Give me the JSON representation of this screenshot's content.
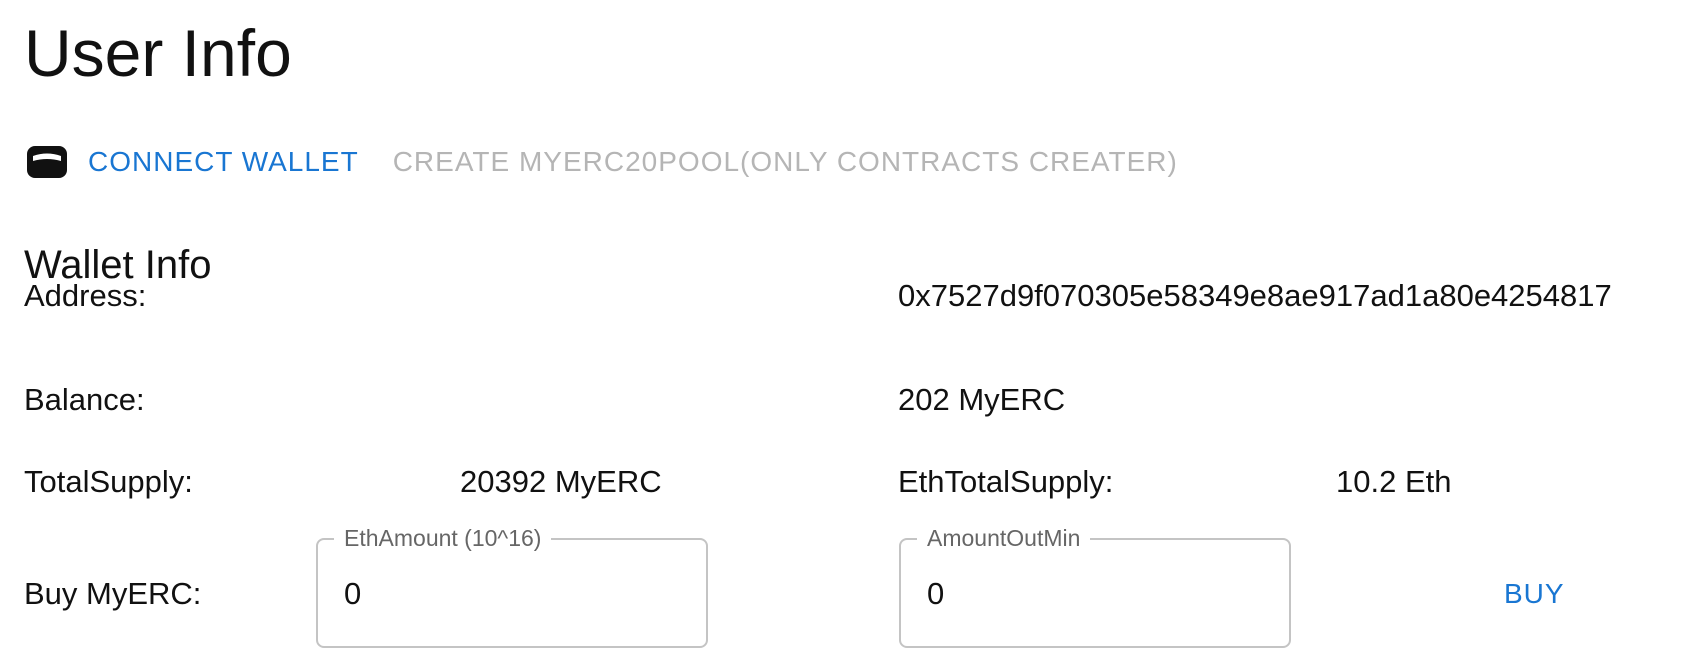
{
  "header": {
    "title": "User Info"
  },
  "toolbar": {
    "connect_wallet_label": "CONNECT WALLET",
    "connect_wallet_icon": "wallet-icon",
    "create_pool_label": "CREATE MYERC20POOL(ONLY CONTRACTS CREATER)"
  },
  "wallet": {
    "title": "Wallet Info",
    "address_label": "Address:",
    "address_value": "0x7527d9f070305e58349e8ae917ad1a80e4254817",
    "balance_label": "Balance:",
    "balance_value": "202 MyERC",
    "total_supply_label": "TotalSupply:",
    "total_supply_value": "20392 MyERC",
    "eth_total_supply_label": "EthTotalSupply:",
    "eth_total_supply_value": "10.2 Eth"
  },
  "buy": {
    "label": "Buy MyERC:",
    "eth_amount_label": "EthAmount (10^16)",
    "eth_amount_value": "0",
    "amount_out_min_label": "AmountOutMin",
    "amount_out_min_value": "0",
    "button_label": "BUY"
  },
  "colors": {
    "primary": "#1976d2",
    "disabled": "#b5b5b5",
    "text": "#111111",
    "field_border": "#c4c4c4",
    "field_label": "#666666"
  }
}
